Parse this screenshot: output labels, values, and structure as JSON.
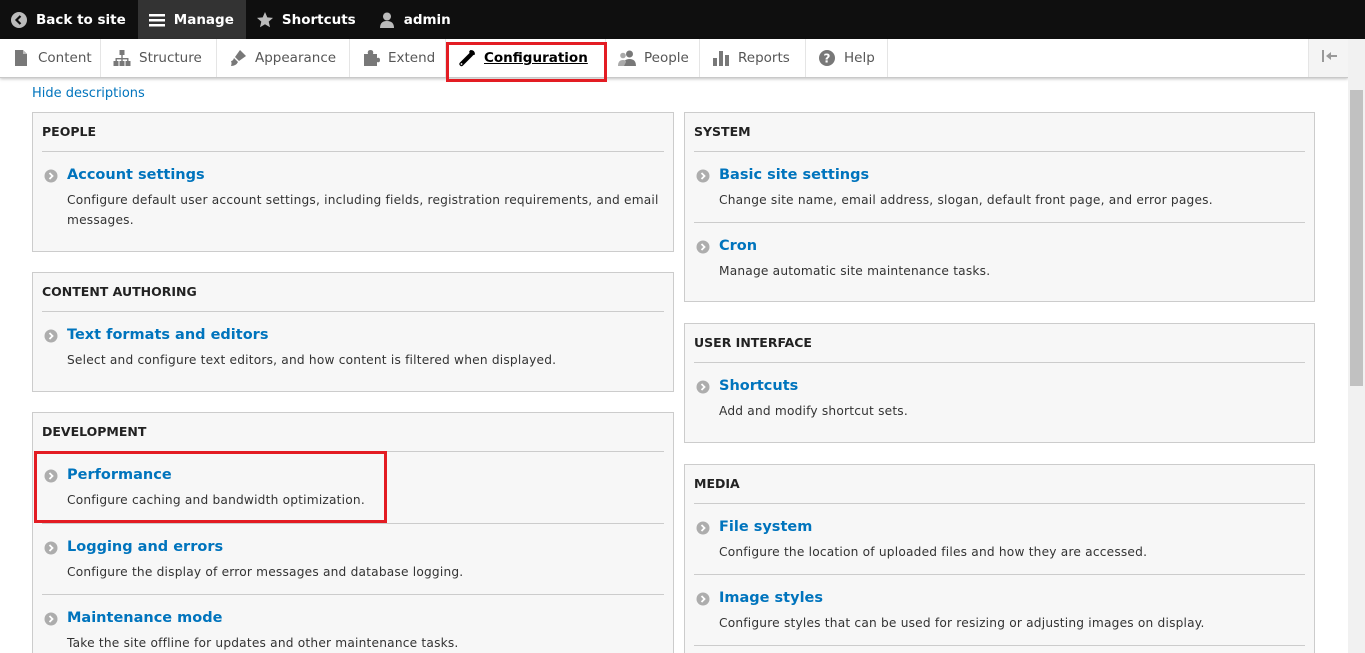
{
  "toolbar": {
    "back_to_site": "Back to site",
    "manage": "Manage",
    "shortcuts": "Shortcuts",
    "user": "admin"
  },
  "tray": {
    "items": [
      {
        "label": "Content",
        "icon": "page-icon"
      },
      {
        "label": "Structure",
        "icon": "sitemap-icon"
      },
      {
        "label": "Appearance",
        "icon": "brush-icon"
      },
      {
        "label": "Extend",
        "icon": "puzzle-icon"
      },
      {
        "label": "Configuration",
        "icon": "wrench-icon",
        "active": true
      },
      {
        "label": "People",
        "icon": "people-icon"
      },
      {
        "label": "Reports",
        "icon": "bar-chart-icon"
      },
      {
        "label": "Help",
        "icon": "help-icon"
      }
    ]
  },
  "hide_descriptions": "Hide descriptions",
  "panels": {
    "people": {
      "title": "PEOPLE",
      "entries": [
        {
          "link": "Account settings",
          "desc": "Configure default user account settings, including fields, registration requirements, and email messages."
        }
      ]
    },
    "content_authoring": {
      "title": "CONTENT AUTHORING",
      "entries": [
        {
          "link": "Text formats and editors",
          "desc": "Select and configure text editors, and how content is filtered when displayed."
        }
      ]
    },
    "development": {
      "title": "DEVELOPMENT",
      "entries": [
        {
          "link": "Performance",
          "desc": "Configure caching and bandwidth optimization."
        },
        {
          "link": "Logging and errors",
          "desc": "Configure the display of error messages and database logging."
        },
        {
          "link": "Maintenance mode",
          "desc": "Take the site offline for updates and other maintenance tasks."
        }
      ]
    },
    "system": {
      "title": "SYSTEM",
      "entries": [
        {
          "link": "Basic site settings",
          "desc": "Change site name, email address, slogan, default front page, and error pages."
        },
        {
          "link": "Cron",
          "desc": "Manage automatic site maintenance tasks."
        }
      ]
    },
    "user_interface": {
      "title": "USER INTERFACE",
      "entries": [
        {
          "link": "Shortcuts",
          "desc": "Add and modify shortcut sets."
        }
      ]
    },
    "media": {
      "title": "MEDIA",
      "entries": [
        {
          "link": "File system",
          "desc": "Configure the location of uploaded files and how they are accessed."
        },
        {
          "link": "Image styles",
          "desc": "Configure styles that can be used for resizing or adjusting images on display."
        }
      ]
    }
  },
  "colors": {
    "link": "#0074bd",
    "highlight": "#e31c23",
    "toolbar_bg": "#0f0f0f"
  }
}
